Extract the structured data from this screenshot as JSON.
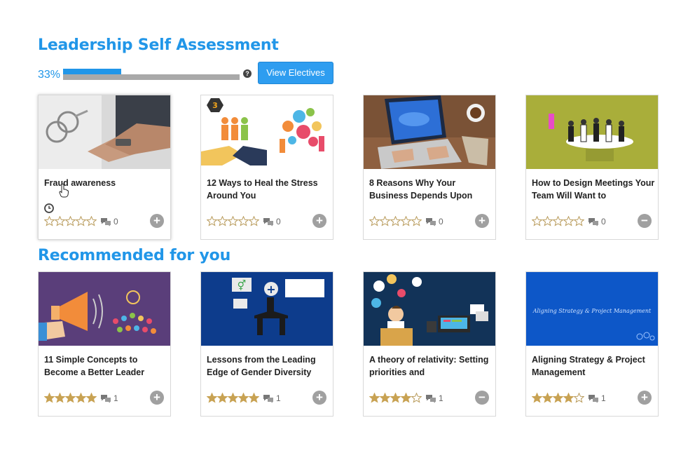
{
  "section1": {
    "title": "Leadership Self Assessment",
    "progress_text": "33%",
    "progress_value": 0.33,
    "help_icon": "question-circle-icon",
    "electives_button": "View Electives"
  },
  "section2": {
    "title": "Recommended for you"
  },
  "colors": {
    "accent": "#2196e8",
    "star_filled": "#c8a253",
    "star_empty": "#b89a5a",
    "action_button": "#a0a0a0"
  },
  "cards_row1": [
    {
      "title": "Fraud awareness",
      "rating": 0,
      "comments": "0",
      "action": "plus",
      "clock": true
    },
    {
      "title": "12 Ways to Heal the Stress Around You",
      "rating": 0,
      "comments": "0",
      "action": "plus",
      "badge": "3"
    },
    {
      "title": "8 Reasons Why Your Business Depends Upon",
      "rating": 0,
      "comments": "0",
      "action": "plus"
    },
    {
      "title": "How to Design Meetings Your Team Will Want to",
      "rating": 0,
      "comments": "0",
      "action": "minus"
    }
  ],
  "cards_row2": [
    {
      "title": "11 Simple Concepts to Become a Better Leader",
      "rating": 5,
      "comments": "1",
      "action": "plus"
    },
    {
      "title": "Lessons from the Leading Edge of Gender Diversity",
      "rating": 5,
      "comments": "1",
      "action": "plus"
    },
    {
      "title": "A theory of relativity: Setting priorities and",
      "rating": 4,
      "comments": "1",
      "action": "minus"
    },
    {
      "title": "Aligning Strategy & Project Management",
      "rating": 4,
      "comments": "1",
      "action": "plus",
      "thumb_text": "Aligning Strategy & Project Management"
    }
  ]
}
